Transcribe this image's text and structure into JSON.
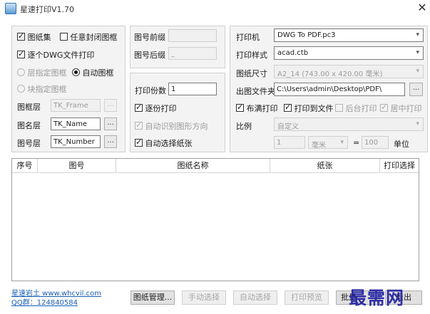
{
  "window": {
    "title": "星速打印V1.70",
    "close_glyph": "✕"
  },
  "left_panel": {
    "drawing_set_label": "图纸集",
    "drawing_set_checked": true,
    "any_closed_frame_label": "任意封闭图框",
    "any_closed_frame_checked": false,
    "per_dwg_label": "逐个DWG文件打印",
    "per_dwg_checked": true,
    "layer_frame_label": "层指定图框",
    "auto_frame_label": "自动图框",
    "block_frame_label": "块指定图框",
    "frame_layer_label": "图框层",
    "frame_layer_value": "TK_Frame",
    "name_layer_label": "图名层",
    "name_layer_value": "TK_Name",
    "number_layer_label": "图号层",
    "number_layer_value": "TK_Number",
    "browse_label": "..."
  },
  "middle_panel": {
    "prefix_label": "图号前缀",
    "prefix_value": "",
    "suffix_label": "图号后缀",
    "suffix_value": "_",
    "copies_label": "打印份数",
    "copies_value": "1",
    "collate_label": "逐份打印",
    "collate_checked": true,
    "auto_orient_label": "自动识别图形方向",
    "auto_orient_checked": true,
    "auto_paper_label": "自动选择纸张",
    "auto_paper_checked": true
  },
  "right_panel": {
    "printer_label": "打印机",
    "printer_value": "DWG To PDF.pc3",
    "style_label": "打印样式",
    "style_value": "acad.ctb",
    "paper_label": "图纸尺寸",
    "paper_value": "A2_14 (743.00 x 420.00 毫米)",
    "output_label": "出图文件夹",
    "output_value": "C:\\Users\\admin\\Desktop\\PDF\\",
    "browse_label": "...",
    "fill_label": "布满打印",
    "fill_checked": true,
    "to_file_label": "打印到文件",
    "to_file_checked": true,
    "reverse_label": "后台打印",
    "reverse_checked": false,
    "center_label": "居中打印",
    "center_checked": true,
    "scale_label": "比例",
    "scale_value": "自定义",
    "scale_num": "1",
    "unit_value": "毫米",
    "equals": "=",
    "scale_den": "100",
    "unit_label": "单位"
  },
  "list": {
    "columns": [
      "序号",
      "图号",
      "图纸名称",
      "纸张",
      "打印选择"
    ]
  },
  "footer": {
    "link1": "星速岩土 www.whcvil.com",
    "link2": "QQ群：124840584",
    "manage_button": "图纸管理...",
    "manual_select_button": "手动选择",
    "auto_select_button": "自动选择",
    "preview_button": "打印预览",
    "batch_button": "批量",
    "exit_button": "退出",
    "watermark": "最需网"
  },
  "colors": {
    "panel_bg": "#f3f3f3",
    "watermark": "#2e2ea6",
    "link": "#1a5fb4"
  }
}
